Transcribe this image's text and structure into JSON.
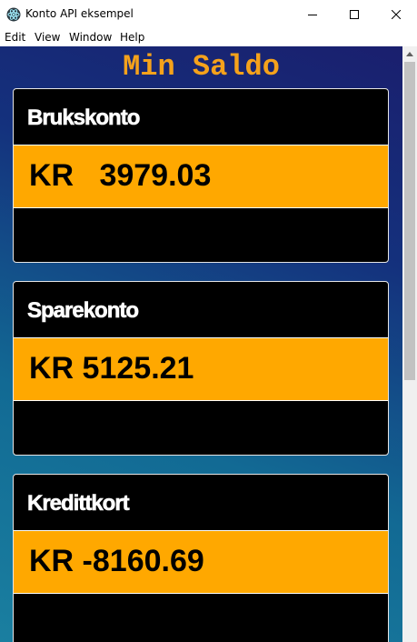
{
  "window": {
    "title": "Konto API eksempel",
    "icon": "electron-atom-icon"
  },
  "menu": {
    "items": [
      "Edit",
      "View",
      "Window",
      "Help"
    ]
  },
  "page": {
    "heading": "Min Saldo",
    "heading_color": "#f5a21b"
  },
  "accounts": [
    {
      "name": "Brukskonto",
      "balance": "KR   3979.03"
    },
    {
      "name": "Sparekonto",
      "balance": "KR 5125.21"
    },
    {
      "name": "Kredittkort",
      "balance": "KR -8160.69"
    }
  ],
  "colors": {
    "card_background": "#000000",
    "balance_band": "#ffa800",
    "background_gradient": [
      "#1a1f6e",
      "#1a7fa0"
    ]
  }
}
